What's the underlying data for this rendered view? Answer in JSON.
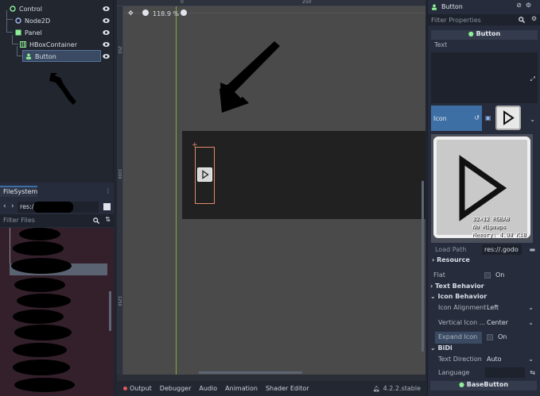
{
  "scene_tree": {
    "nodes": [
      {
        "label": "Control",
        "depth": 0,
        "icon": "control-circle-icon",
        "color": "#8eef97"
      },
      {
        "label": "Node2D",
        "depth": 1,
        "icon": "node2d-circle-icon",
        "color": "#a5b7f3"
      },
      {
        "label": "Panel",
        "depth": 1,
        "icon": "panel-icon",
        "color": "#8eef97"
      },
      {
        "label": "HBoxContainer",
        "depth": 2,
        "icon": "hbox-icon",
        "color": "#8eef97"
      },
      {
        "label": "Button",
        "depth": 3,
        "icon": "button-person-icon",
        "color": "#8eef97",
        "selected": true
      }
    ]
  },
  "filesystem": {
    "tab_label": "FileSystem",
    "path_value": "res://",
    "filter_placeholder": "Filter Files"
  },
  "viewport": {
    "zoom_label": "118.9 %",
    "ruler_marks": [
      "0",
      "250"
    ],
    "ruler_left_marks": [
      "250",
      "1000",
      "1250"
    ]
  },
  "bottom_panel": {
    "tabs": [
      "Output",
      "Debugger",
      "Audio",
      "Animation",
      "Shader Editor"
    ],
    "version": "4.2.2.stable"
  },
  "inspector": {
    "node_name": "Button",
    "filter_placeholder": "Filter Properties",
    "section_button": "Button",
    "text_label": "Text",
    "icon_label": "Icon",
    "texture_info": [
      "32×32 RGBA8",
      "No Mipmaps",
      "Memory: 4.00 KiB"
    ],
    "load_path_label": "Load Path",
    "load_path_value": "res://.godo",
    "resource_label": "Resource",
    "flat_label": "Flat",
    "flat_value": "On",
    "text_behavior": "Text Behavior",
    "icon_behavior": "Icon Behavior",
    "icon_alignment_label": "Icon Alignment",
    "icon_alignment_value": "Left",
    "vertical_icon_label": "Vertical Icon ...",
    "vertical_icon_value": "Center",
    "expand_icon_label": "Expand Icon",
    "expand_icon_value": "On",
    "bidi": "BiDi",
    "text_direction_label": "Text Direction",
    "text_direction_value": "Auto",
    "language_label": "Language",
    "base_button": "BaseButton",
    "accent": "#3d6fa5"
  }
}
